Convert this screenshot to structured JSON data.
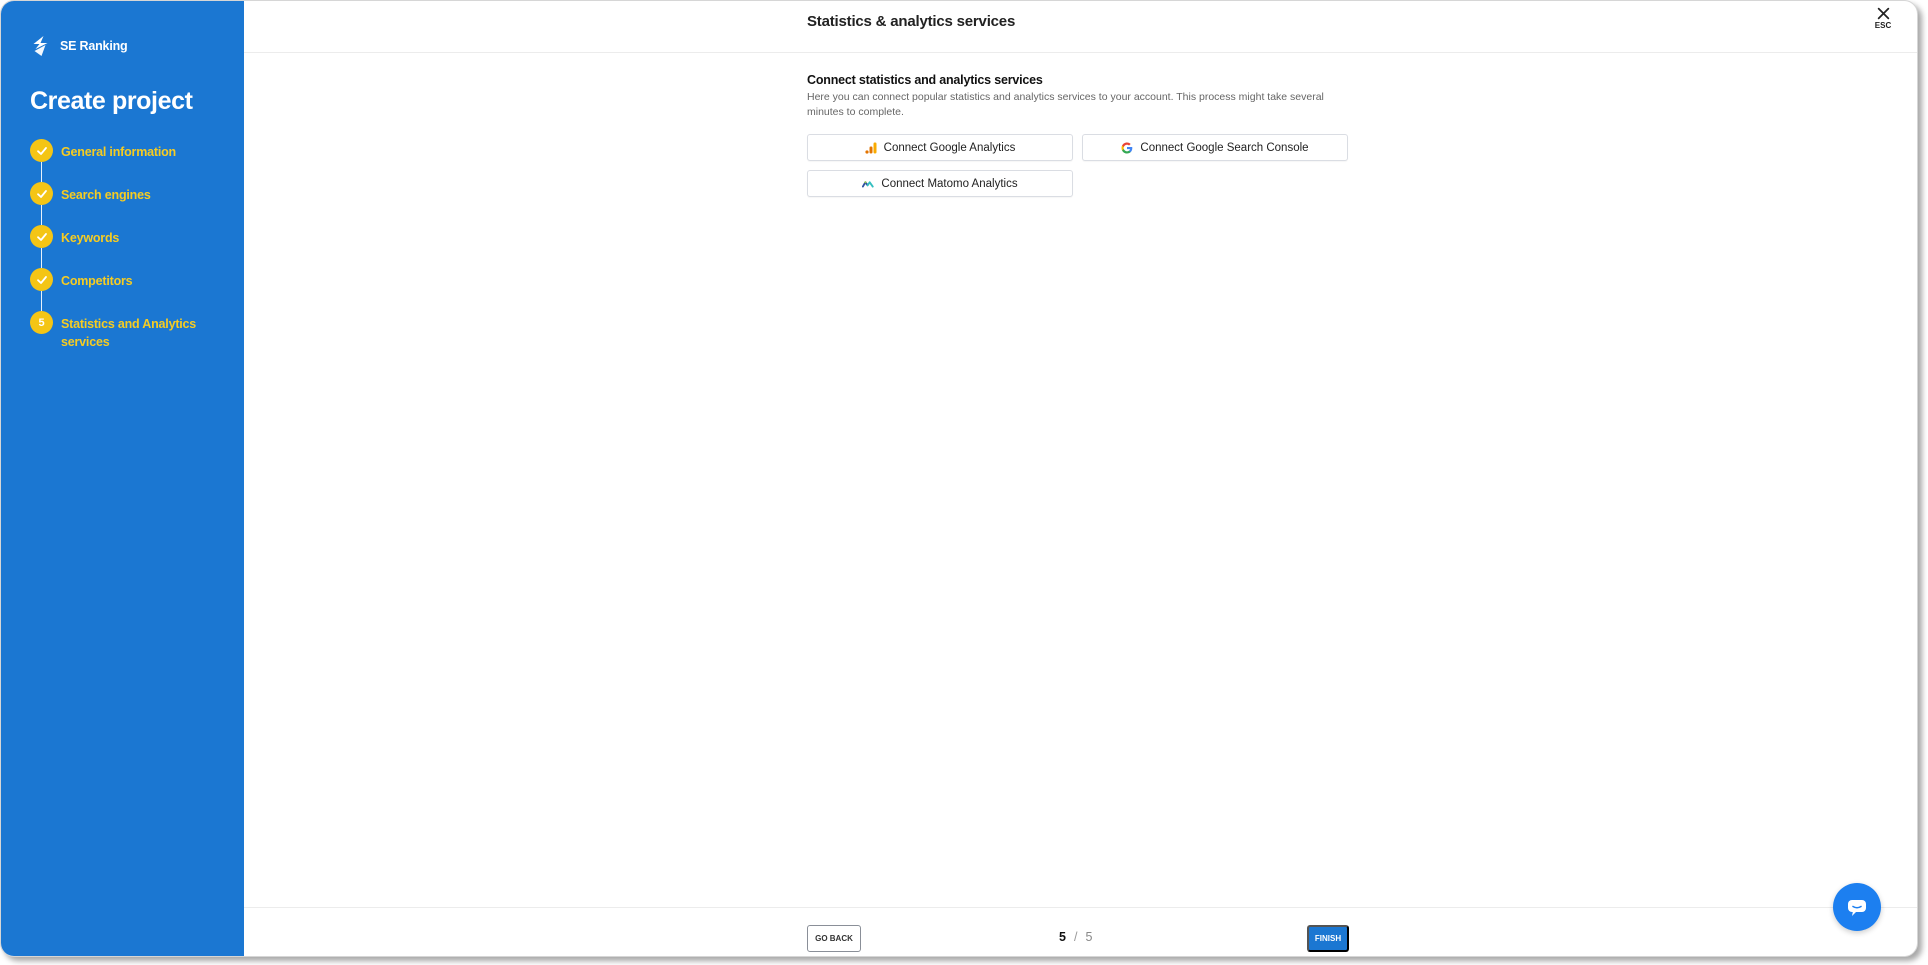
{
  "sidebar": {
    "logo_text": "SE Ranking",
    "title": "Create project",
    "steps": [
      {
        "label": "General information",
        "state": "done"
      },
      {
        "label": "Search engines",
        "state": "done"
      },
      {
        "label": "Keywords",
        "state": "done"
      },
      {
        "label": "Competitors",
        "state": "done"
      },
      {
        "label": "Statistics and Analytics services",
        "state": "current",
        "number": "5"
      }
    ]
  },
  "header": {
    "title": "Statistics & analytics services",
    "close_label": "ESC"
  },
  "main": {
    "section_title": "Connect statistics and analytics services",
    "section_description": "Here you can connect popular statistics and analytics services to your account. This process might take several minutes to complete.",
    "buttons": [
      {
        "label": "Connect Google Analytics",
        "icon": "google-analytics-icon"
      },
      {
        "label": "Connect Google Search Console",
        "icon": "google-icon"
      },
      {
        "label": "Connect Matomo Analytics",
        "icon": "matomo-icon"
      }
    ]
  },
  "footer": {
    "back_label": "GO BACK",
    "current_page": "5",
    "page_separator": "/",
    "total_pages": "5",
    "finish_label": "FINISH"
  },
  "colors": {
    "sidebar_bg": "#1b77d2",
    "step_accent": "#f4c515",
    "primary": "#1b77d2",
    "chat_bubble": "#1c7ff0"
  }
}
